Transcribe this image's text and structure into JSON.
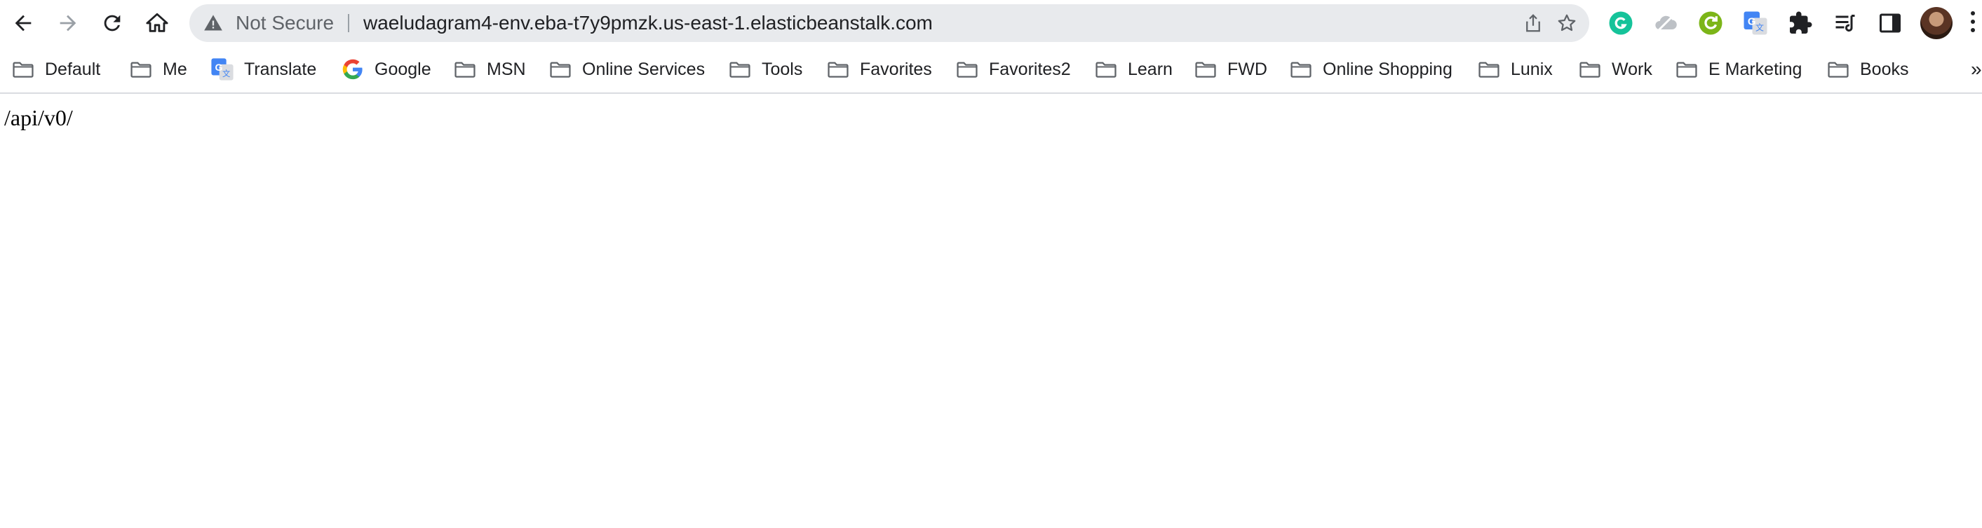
{
  "browser": {
    "security_label": "Not Secure",
    "url": "waeludagram4-env.eba-t7y9pmzk.us-east-1.elasticbeanstalk.com",
    "nav_icons": [
      "back-arrow-icon",
      "forward-arrow-icon",
      "reload-icon",
      "home-icon"
    ],
    "omnibox_actions": [
      "share-icon",
      "bookmark-star-icon"
    ],
    "extensions": [
      "grammarly-icon",
      "cloud-sync-icon",
      "green-refresh-icon",
      "google-translate-icon",
      "puzzle-piece-icon",
      "reading-list-icon",
      "side-panel-icon"
    ],
    "overflow_label": "»"
  },
  "bookmarks": [
    {
      "label": "Default",
      "icon": "folder-icon"
    },
    {
      "label": "Me",
      "icon": "folder-icon"
    },
    {
      "label": "Translate",
      "icon": "google-translate-icon"
    },
    {
      "label": "Google",
      "icon": "google-g-icon"
    },
    {
      "label": "MSN",
      "icon": "folder-icon"
    },
    {
      "label": "Online Services",
      "icon": "folder-icon"
    },
    {
      "label": "Tools",
      "icon": "folder-icon"
    },
    {
      "label": "Favorites",
      "icon": "folder-icon"
    },
    {
      "label": "Favorites2",
      "icon": "folder-icon"
    },
    {
      "label": "Learn",
      "icon": "folder-icon"
    },
    {
      "label": "FWD",
      "icon": "folder-icon"
    },
    {
      "label": "Online Shopping",
      "icon": "folder-icon"
    },
    {
      "label": "Lunix",
      "icon": "folder-icon"
    },
    {
      "label": "Work",
      "icon": "folder-icon"
    },
    {
      "label": "E Marketing",
      "icon": "folder-icon"
    },
    {
      "label": "Books",
      "icon": "folder-icon"
    }
  ],
  "page": {
    "text": "/api/v0/"
  },
  "colors": {
    "omnibox_bg": "#e8eaed",
    "grammarly": "#15c39a",
    "refresh_green": "#7cb518",
    "translate_blue": "#4285f4"
  }
}
